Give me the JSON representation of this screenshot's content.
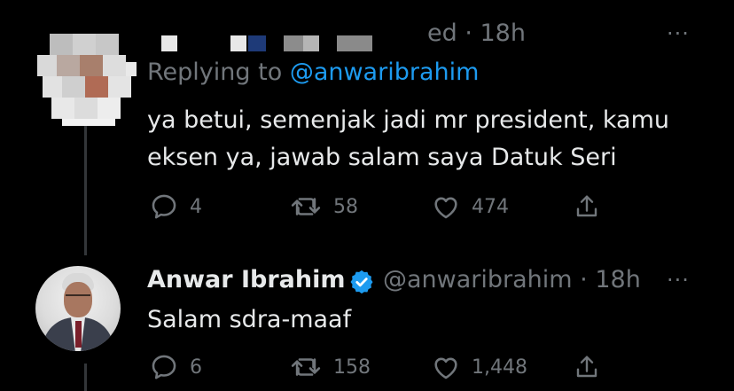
{
  "colors": {
    "background": "#000000",
    "text": "#e7e9ea",
    "muted": "#71767b",
    "link": "#1d9bf0",
    "verified": "#1d9bf0",
    "line": "#333639"
  },
  "tweet1": {
    "time_partial": "ed · 18h",
    "replying_prefix": "Replying to",
    "replying_handle": "@anwaribrahim",
    "line1": "ya betui, semenjak jadi mr president, kamu",
    "line2": "eksen ya, jawab salam saya Datuk Seri",
    "replies": "4",
    "retweets": "58",
    "likes": "474",
    "more": "···"
  },
  "tweet2": {
    "name": "Anwar Ibrahim",
    "handle_time": "@anwaribrahim · 18h",
    "text": "Salam sdra-maaf",
    "replies": "6",
    "retweets": "158",
    "likes": "1,448",
    "more": "···"
  },
  "icons": [
    "reply-icon",
    "retweet-icon",
    "like-icon",
    "share-icon",
    "verified-badge-icon",
    "more-icon"
  ]
}
